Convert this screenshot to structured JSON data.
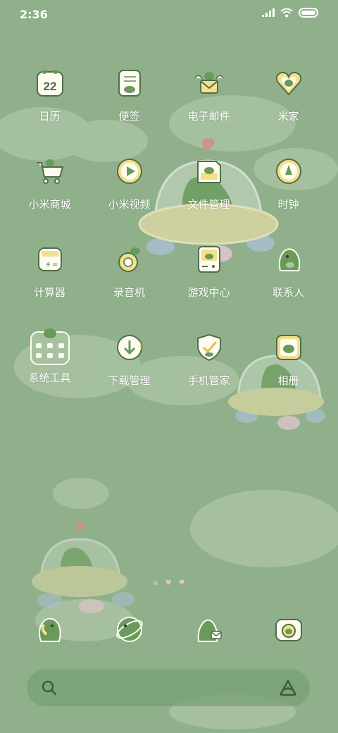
{
  "status_bar": {
    "time": "2:36",
    "icons": [
      "signal-icon",
      "wifi-icon",
      "battery-icon"
    ]
  },
  "apps": [
    {
      "label": "日历",
      "icon": "calendar-icon",
      "icon_text": "22"
    },
    {
      "label": "便签",
      "icon": "notes-icon"
    },
    {
      "label": "电子邮件",
      "icon": "email-icon"
    },
    {
      "label": "米家",
      "icon": "mijia-icon"
    },
    {
      "label": "小米商城",
      "icon": "shopping-cart-icon"
    },
    {
      "label": "小米视频",
      "icon": "video-icon"
    },
    {
      "label": "文件管理",
      "icon": "folder-icon"
    },
    {
      "label": "时钟",
      "icon": "clock-icon"
    },
    {
      "label": "计算器",
      "icon": "calculator-icon"
    },
    {
      "label": "录音机",
      "icon": "recorder-icon"
    },
    {
      "label": "游戏中心",
      "icon": "game-center-icon"
    },
    {
      "label": "联系人",
      "icon": "contacts-icon"
    },
    {
      "label": "系统工具",
      "icon": "system-tools-folder-icon"
    },
    {
      "label": "下载管理",
      "icon": "download-icon"
    },
    {
      "label": "手机管家",
      "icon": "security-shield-icon"
    },
    {
      "label": "相册",
      "icon": "gallery-icon"
    }
  ],
  "page_indicator": {
    "pages": 3,
    "current": 1
  },
  "dock": [
    {
      "icon": "phone-icon"
    },
    {
      "icon": "browser-icon"
    },
    {
      "icon": "messages-icon"
    },
    {
      "icon": "camera-icon"
    }
  ],
  "search_bar": {
    "placeholder": ""
  },
  "colors": {
    "background": "#8fb08a",
    "icon_plate": "#fdfbf2",
    "dino_green": "#6a9a5a",
    "accent_yellow": "#e8d98a",
    "heart_pink": "#d99090"
  }
}
